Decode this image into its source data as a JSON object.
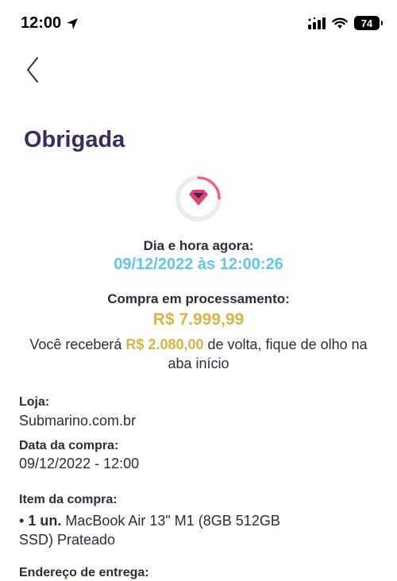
{
  "status_bar": {
    "time": "12:00",
    "battery": "74"
  },
  "page": {
    "title": "Obrigada"
  },
  "timestamp": {
    "label": "Dia e hora agora:",
    "value": "09/12/2022 às 12:00:26"
  },
  "purchase": {
    "status_label": "Compra em processamento:",
    "amount": "R$ 7.999,99",
    "cashback_prefix": "Você receberá ",
    "cashback_amount": "R$ 2.080,00",
    "cashback_suffix": " de volta, fique de olho na aba início"
  },
  "details": {
    "store_label": "Loja:",
    "store_value": "Submarino.com.br",
    "date_label": "Data da compra:",
    "date_value": "09/12/2022 - 12:00",
    "item_label": "Item da compra:",
    "item_bullet": "• ",
    "item_qty": "1 un.",
    "item_name": " MacBook Air 13\" M1 (8GB 512GB SSD) Prateado",
    "address_label": "Endereço de entrega:"
  },
  "colors": {
    "title": "#3b2a5c",
    "timestamp": "#5ec7ea",
    "amount": "#d6b547",
    "heart": "#e8426a",
    "loader_arc": "#ef5a78"
  },
  "icons": {
    "location": "location-arrow-icon",
    "signal": "signal-icon",
    "wifi": "wifi-icon",
    "back": "chevron-left-icon",
    "loader": "heart-loader-icon"
  }
}
